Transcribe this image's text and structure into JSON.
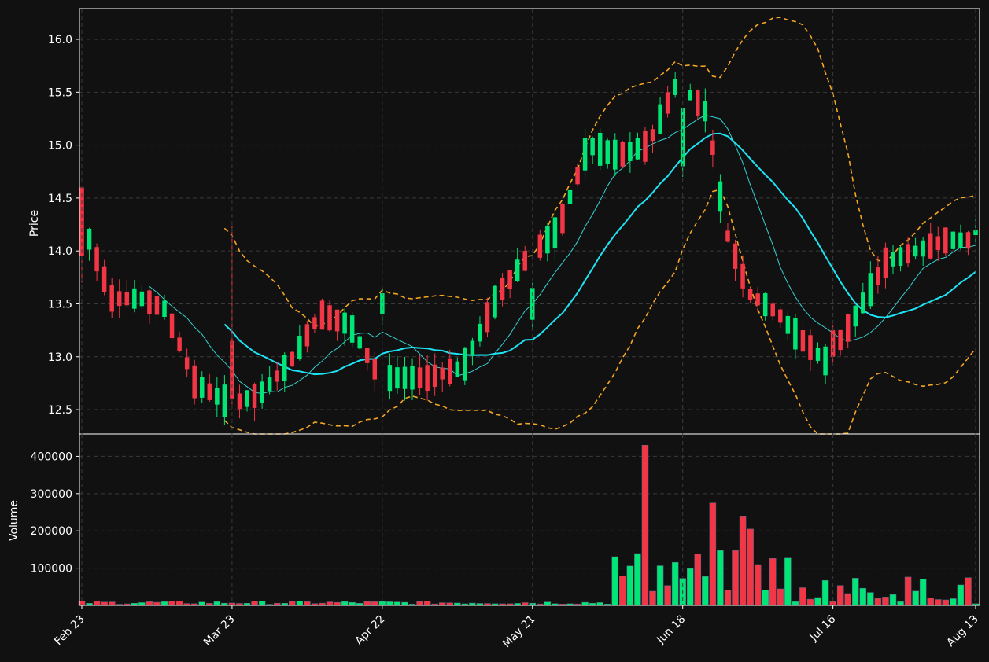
{
  "chart_data": [
    {
      "type": "candlestick",
      "ylabel": "Price",
      "yticks": [
        "12.5",
        "13.0",
        "13.5",
        "14.0",
        "14.5",
        "15.0",
        "15.5",
        "16.0"
      ],
      "ylim": [
        12.27,
        16.29
      ],
      "grid": true,
      "candle_colors": {
        "up": "#00e676",
        "down": "#f23645"
      },
      "ohlc_sample": [
        {
          "date": "Feb 23",
          "open": 14.6,
          "high": 14.6,
          "low": 13.7,
          "close": 13.95
        },
        {
          "date": "Mar 23",
          "open": 13.15,
          "high": 14.24,
          "low": 12.55,
          "close": 12.6
        },
        {
          "date": "Apr 22",
          "open": 13.4,
          "high": 13.65,
          "low": 13.3,
          "close": 13.6
        },
        {
          "date": "May 21",
          "open": 13.35,
          "high": 13.7,
          "low": 13.25,
          "close": 13.65
        },
        {
          "date": "Jun 18",
          "open": 14.8,
          "high": 15.35,
          "low": 14.7,
          "close": 15.35
        },
        {
          "date": "Jul 16",
          "open": 13.25,
          "high": 13.3,
          "low": 12.95,
          "close": 13.0
        },
        {
          "date": "Aug 13",
          "open": 14.15,
          "high": 14.3,
          "low": 14.05,
          "close": 14.2
        }
      ],
      "overlays": [
        {
          "name": "",
          "style": "solid-thin",
          "color": "#35d0d0"
        },
        {
          "name": "",
          "style": "solid",
          "color": "#1ee3f5"
        },
        {
          "name": "",
          "style": "dashed",
          "color": "#f5a623"
        },
        {
          "name": "",
          "style": "dashed",
          "color": "#f5a623"
        }
      ]
    },
    {
      "type": "bar",
      "ylabel": "Volume",
      "yticks": [
        "100000",
        "200000",
        "300000",
        "400000"
      ],
      "ylim": [
        0,
        460000
      ],
      "grid": true,
      "peak_volume": 430000,
      "xticks": [
        "Feb 23",
        "Mar 23",
        "Apr 22",
        "May 21",
        "Jun 18",
        "Jul 16",
        "Aug 13"
      ]
    }
  ]
}
